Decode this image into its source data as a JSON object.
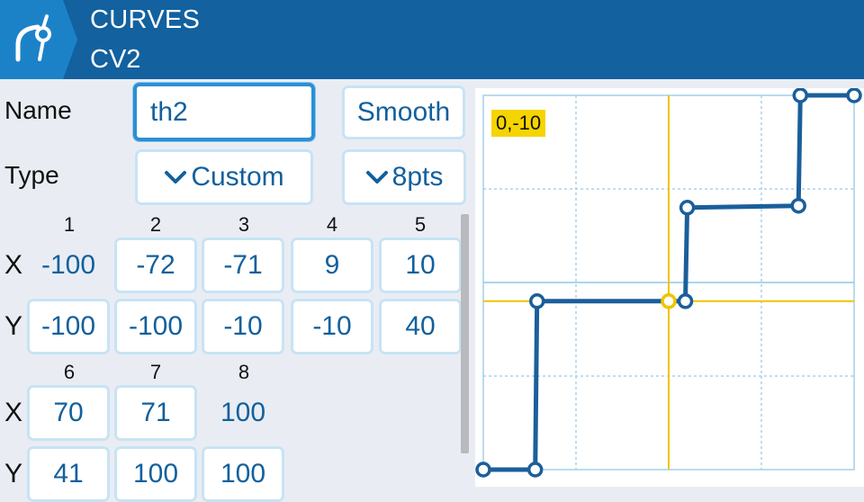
{
  "header": {
    "title": "CURVES",
    "subtitle": "CV2",
    "icon": "curve-icon"
  },
  "name_label": "Name",
  "name_value": "th2",
  "smooth_label": "Smooth",
  "type_label": "Type",
  "type_value": "Custom",
  "points_value": "8pts",
  "columns_top": [
    "1",
    "2",
    "3",
    "4",
    "5"
  ],
  "x_label": "X",
  "y_label": "Y",
  "row1_x": [
    "-100",
    "-72",
    "-71",
    "9",
    "10"
  ],
  "row1_y": [
    "-100",
    "-100",
    "-10",
    "-10",
    "40"
  ],
  "columns_bottom": [
    "6",
    "7",
    "8"
  ],
  "row2_x": [
    "70",
    "71",
    "100"
  ],
  "row2_y": [
    "41",
    "100",
    "100"
  ],
  "coord_badge": "0,-10",
  "colors": {
    "header": "#13619e",
    "accent": "#1c82c8",
    "curve": "#1a5f9b",
    "cursor": "#f5d400"
  },
  "chart_data": {
    "type": "line",
    "x": [
      -100,
      -72,
      -71,
      9,
      10,
      70,
      71,
      100
    ],
    "y": [
      -100,
      -100,
      -10,
      -10,
      40,
      41,
      100,
      100
    ],
    "xlim": [
      -100,
      100
    ],
    "ylim": [
      -100,
      100
    ],
    "grid": true,
    "cursor": {
      "x": 0,
      "y": -10
    }
  }
}
